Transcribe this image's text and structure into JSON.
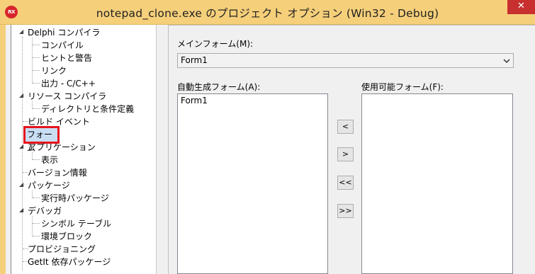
{
  "window": {
    "title": "notepad_clone.exe のプロジェクト オプション (Win32 - Debug)",
    "app_icon_text": "RX",
    "close_glyph": "✕"
  },
  "tree": {
    "items": [
      {
        "label": "Delphi コンパイラ"
      },
      {
        "label": "コンパイル"
      },
      {
        "label": "ヒントと警告"
      },
      {
        "label": "リンク"
      },
      {
        "label": "出力 - C/C++"
      },
      {
        "label": "リソース コンパイラ"
      },
      {
        "label": "ディレクトリと条件定義"
      },
      {
        "label": "ビルド イベント"
      },
      {
        "label": "フォーム"
      },
      {
        "label": "アプリケーション"
      },
      {
        "label": "表示"
      },
      {
        "label": "バージョン情報"
      },
      {
        "label": "パッケージ"
      },
      {
        "label": "実行時パッケージ"
      },
      {
        "label": "デバッガ"
      },
      {
        "label": "シンボル テーブル"
      },
      {
        "label": "環境ブロック"
      },
      {
        "label": "プロビジョニング"
      },
      {
        "label": "GetIt 依存パッケージ"
      }
    ],
    "selected": "フォーム"
  },
  "main_form": {
    "label": "メインフォーム(M):",
    "value": "Form1"
  },
  "auto_create": {
    "label": "自動生成フォーム(A):",
    "items": [
      "Form1"
    ]
  },
  "available": {
    "label": "使用可能フォーム(F):",
    "items": []
  },
  "move_buttons": {
    "move_left": "<",
    "move_right": ">",
    "move_all_left": "<<",
    "move_all_right": ">>"
  },
  "colors": {
    "titlebar": "#f5cf7a",
    "close_button": "#c7302e",
    "selection_highlight": "#e8131c"
  }
}
